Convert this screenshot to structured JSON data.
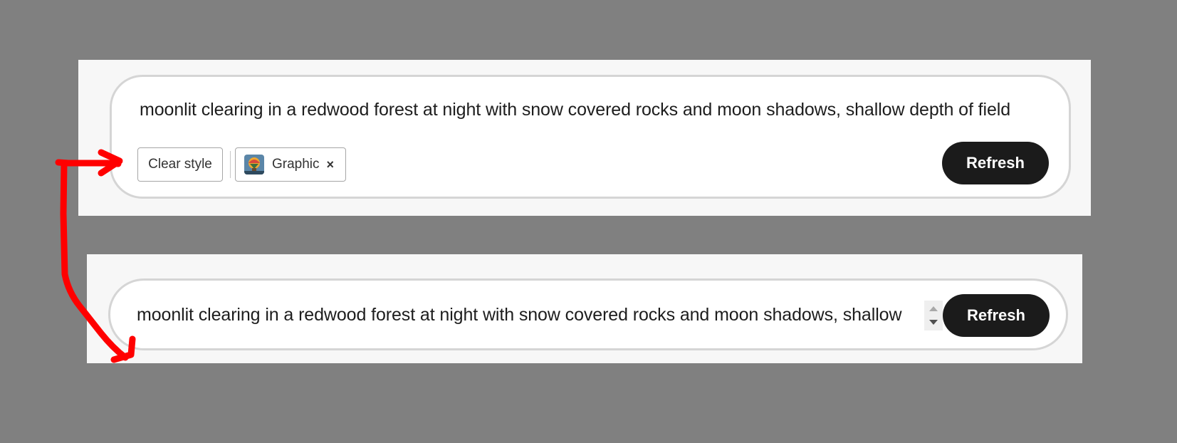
{
  "top_panel": {
    "prompt": "moonlit clearing in a redwood forest at night with snow covered rocks and moon shadows, shallow depth of field",
    "clear_style_label": "Clear style",
    "style_chip_label": "Graphic",
    "style_chip_close": "×",
    "refresh_label": "Refresh"
  },
  "bottom_panel": {
    "prompt": "moonlit clearing in a redwood forest at night with snow covered rocks and moon shadows, shallow",
    "refresh_label": "Refresh"
  },
  "annotation": {
    "color": "#ff0000"
  },
  "icons": {
    "style_thumbnail": "graphic-style-thumbnail-icon",
    "close": "close-icon",
    "scroll_up": "arrow-up-icon",
    "scroll_down": "arrow-down-icon"
  }
}
